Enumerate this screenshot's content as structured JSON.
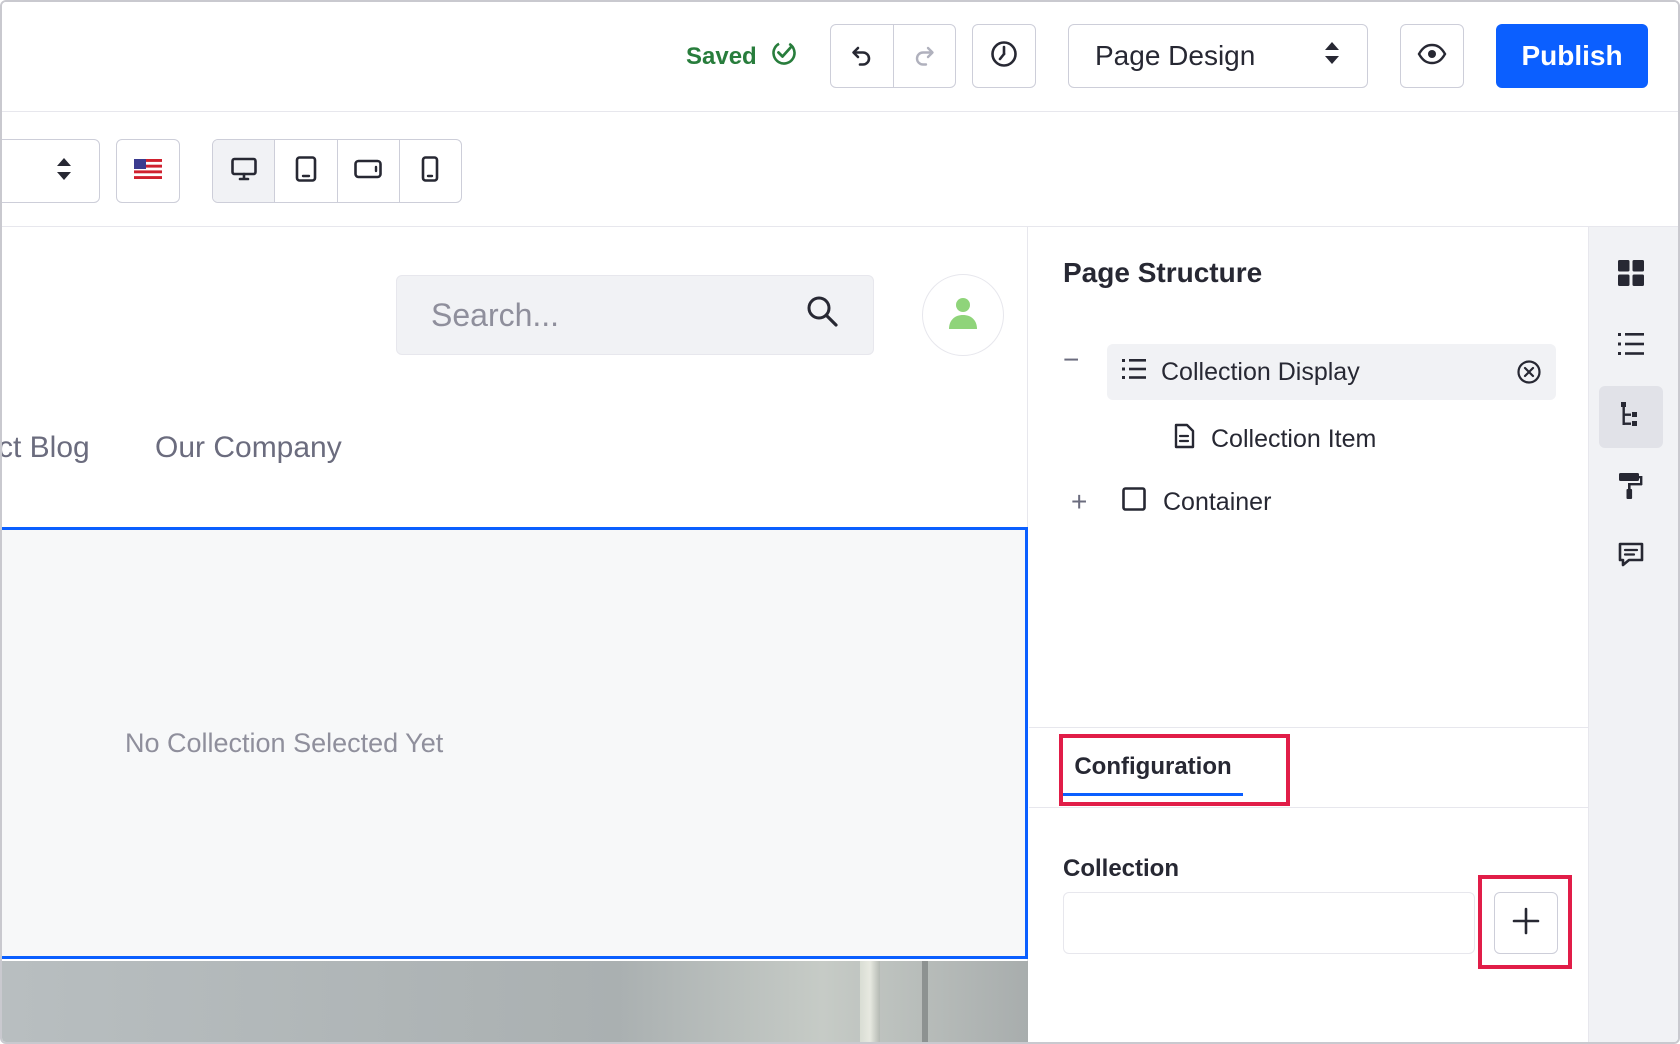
{
  "header": {
    "saved_label": "Saved",
    "mode_select": "Page Design",
    "publish_label": "Publish",
    "accent_color": "#0b5fff",
    "saved_color": "#287d3c"
  },
  "toolbar": {
    "locale_flag": "flag-us-icon",
    "devices": [
      "desktop-icon",
      "tablet-icon",
      "landscape-phone-icon",
      "phone-icon"
    ],
    "active_device": "desktop-icon"
  },
  "canvas": {
    "search_placeholder": "Search...",
    "nav": [
      "ct Blog",
      "Our Company"
    ],
    "empty_message": "No Collection Selected Yet"
  },
  "panel": {
    "title": "Page Structure",
    "tree": [
      {
        "label": "Collection Display",
        "toggle": "−",
        "icon": "list-icon",
        "selected": true
      },
      {
        "label": "Collection Item",
        "icon": "document-icon"
      },
      {
        "label": "Container",
        "toggle": "+",
        "icon": "square-icon"
      }
    ],
    "tab_label": "Configuration",
    "field_label": "Collection",
    "field_value": ""
  },
  "sidebar": {
    "icons": [
      "grid-icon",
      "list-icon",
      "tree-icon",
      "paint-roller-icon",
      "comment-icon"
    ],
    "active": "tree-icon"
  }
}
